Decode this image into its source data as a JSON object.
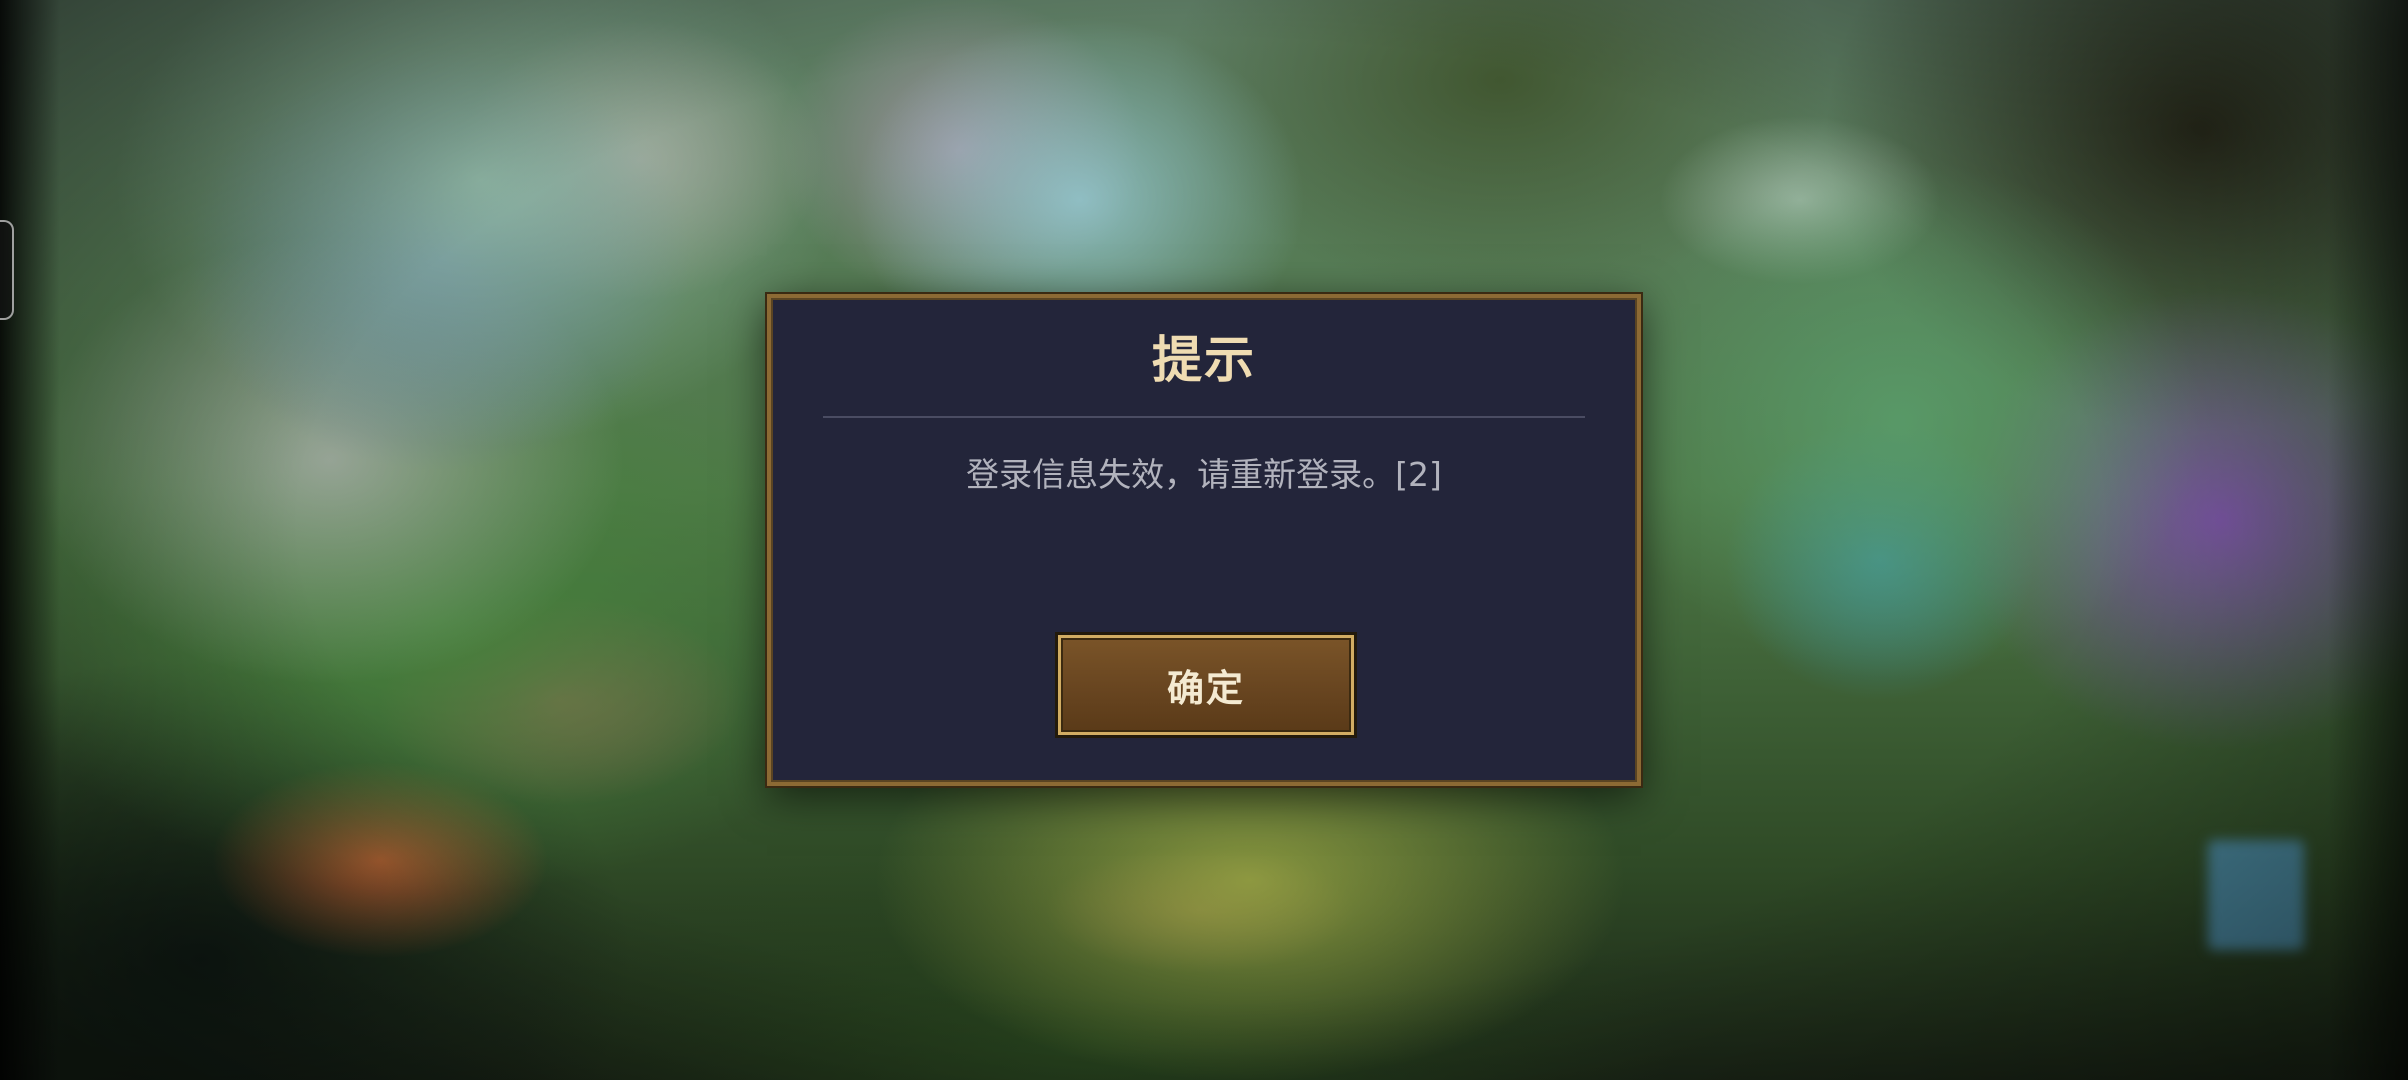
{
  "dialog": {
    "title": "提示",
    "message": "登录信息失效，请重新登录。[2]",
    "confirm_label": "确定"
  },
  "colors": {
    "dialog_background": "#23253a",
    "dialog_border": "#8c6a34",
    "title_text": "#efdcb2",
    "message_text": "#b2b3bd",
    "button_fill": "#6a4620",
    "button_border": "#d2ad63"
  }
}
